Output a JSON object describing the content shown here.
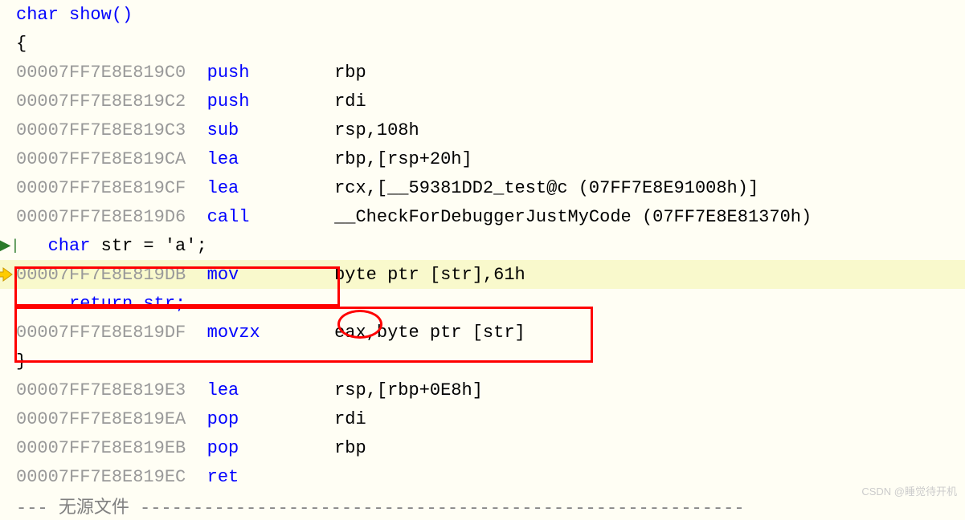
{
  "lines": {
    "l0": "char show()",
    "l1": "{",
    "l2_addr": "00007FF7E8E819C0",
    "l2_mn": "push",
    "l2_op": "rbp  ",
    "l3_addr": "00007FF7E8E819C2",
    "l3_mn": "push",
    "l3_op": "rdi  ",
    "l4_addr": "00007FF7E8E819C3",
    "l4_mn": "sub",
    "l4_op": "rsp,108h  ",
    "l5_addr": "00007FF7E8E819CA",
    "l5_mn": "lea",
    "l5_op": "rbp,[rsp+20h]  ",
    "l6_addr": "00007FF7E8E819CF",
    "l6_mn": "lea",
    "l6_op": "rcx,[__59381DD2_test@c (07FF7E8E91008h)]  ",
    "l7_addr": "00007FF7E8E819D6",
    "l7_mn": "call",
    "l7_op": "__CheckForDebuggerJustMyCode (07FF7E8E81370h)  ",
    "l8_kw": "char",
    "l8_code": " str = 'a';",
    "l9_addr": "00007FF7E8E819DB",
    "l9_mn": "mov",
    "l9_op": "byte ptr [str],61h  ",
    "l10_code": "return str;",
    "l11_addr": "00007FF7E8E819DF",
    "l11_mn": "movzx",
    "l11_op": "eax,byte ptr [str]  ",
    "l12": "}",
    "l13_addr": "00007FF7E8E819E3",
    "l13_mn": "lea",
    "l13_op": "rsp,[rbp+0E8h]  ",
    "l14_addr": "00007FF7E8E819EA",
    "l14_mn": "pop",
    "l14_op": "rdi  ",
    "l15_addr": "00007FF7E8E819EB",
    "l15_mn": "pop",
    "l15_op": "rbp  ",
    "l16_addr": "00007FF7E8E819EC",
    "l16_mn": "ret",
    "nosrc_label": "无源文件",
    "dashes_pre": "--- ",
    "dashes_post": " ---------------------------------------------------------"
  },
  "watermark": "CSDN @睡觉待开机"
}
